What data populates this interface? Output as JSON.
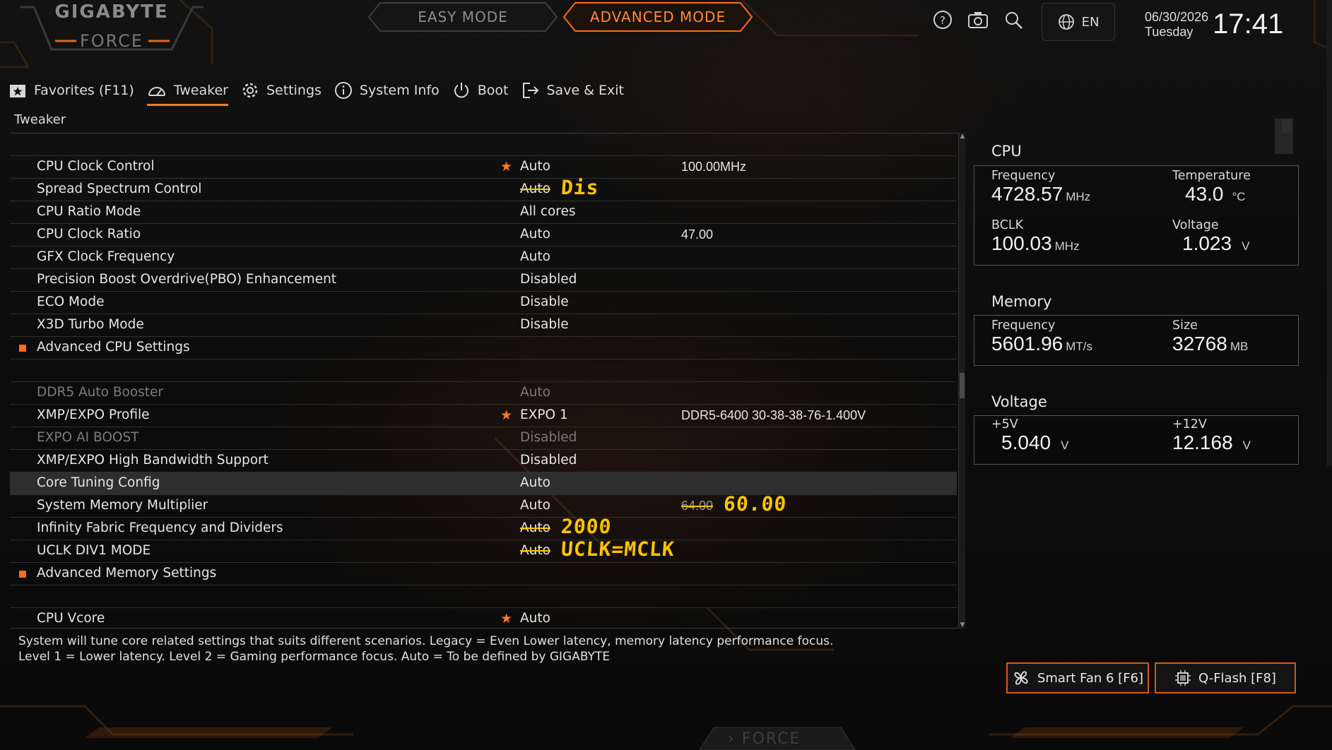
{
  "brand": {
    "line1": "GIGABYTE",
    "line2": "FORCE"
  },
  "modes": {
    "easy": "EASY MODE",
    "advanced": "ADVANCED MODE",
    "active": "advanced"
  },
  "top_icons": [
    "help-icon",
    "screenshot-camera-icon",
    "search-icon"
  ],
  "language": {
    "label": "EN",
    "icon": "globe-icon"
  },
  "datetime": {
    "date": "06/30/2026",
    "day": "Tuesday",
    "time": "17:41"
  },
  "nav": {
    "items": [
      {
        "label": "Favorites (F11)",
        "icon": "star-folder-icon"
      },
      {
        "label": "Tweaker",
        "icon": "speedometer-icon",
        "active": true
      },
      {
        "label": "Settings",
        "icon": "gear-icon"
      },
      {
        "label": "System Info",
        "icon": "info-icon"
      },
      {
        "label": "Boot",
        "icon": "power-icon"
      },
      {
        "label": "Save & Exit",
        "icon": "exit-icon"
      }
    ]
  },
  "breadcrumb": "Tweaker",
  "settings": {
    "rows": [
      {
        "name": "CPU Clock Control",
        "starred": true,
        "value": "Auto",
        "extra": "100.00MHz"
      },
      {
        "name": "Spread Spectrum Control",
        "value": "Auto",
        "struck": true,
        "annotation": "Dis"
      },
      {
        "name": "CPU Ratio Mode",
        "value": "All cores"
      },
      {
        "name": "CPU Clock Ratio",
        "value": "Auto",
        "extra": "47.00"
      },
      {
        "name": "GFX Clock Frequency",
        "value": "Auto"
      },
      {
        "name": "Precision Boost Overdrive(PBO) Enhancement",
        "value": "Disabled"
      },
      {
        "name": "ECO Mode",
        "value": "Disable"
      },
      {
        "name": "X3D Turbo Mode",
        "value": "Disable"
      },
      {
        "name": "Advanced CPU Settings",
        "submenu": true
      },
      {
        "name": "DDR5 Auto Booster",
        "value": "Auto",
        "disabled": true
      },
      {
        "name": "XMP/EXPO Profile",
        "starred": true,
        "value": "EXPO 1",
        "extra": "DDR5-6400 30-38-38-76-1.400V"
      },
      {
        "name": "EXPO AI BOOST",
        "value": "Disabled",
        "disabled": true
      },
      {
        "name": "XMP/EXPO High Bandwidth Support",
        "value": "Disabled"
      },
      {
        "name": "Core Tuning Config",
        "value": "Auto",
        "selected": true
      },
      {
        "name": "System Memory Multiplier",
        "value": "Auto",
        "extra": "64.00",
        "extra_struck": true,
        "annotation": "60.00"
      },
      {
        "name": "Infinity Fabric Frequency and Dividers",
        "value": "Auto",
        "struck": true,
        "annotation": "2000"
      },
      {
        "name": "UCLK DIV1 MODE",
        "value": "Auto",
        "struck": true,
        "annotation": "UCLK=MCLK"
      },
      {
        "name": "Advanced Memory Settings",
        "submenu": true
      },
      {
        "name": "CPU Vcore",
        "starred": true,
        "value": "Auto"
      }
    ]
  },
  "help_text": "System will tune core related settings that suits different scenarios. Legacy = Even Lower latency, memory latency performance focus. Level 1 = Lower latency. Level 2 = Gaming performance focus. Auto = To be defined by GIGABYTE",
  "side": {
    "cpu": {
      "title": "CPU",
      "frequency": {
        "label": "Frequency",
        "value": "4728.57",
        "unit": "MHz"
      },
      "temperature": {
        "label": "Temperature",
        "value": "43.0",
        "unit": "°C"
      },
      "bclk": {
        "label": "BCLK",
        "value": "100.03",
        "unit": "MHz"
      },
      "voltage": {
        "label": "Voltage",
        "value": "1.023",
        "unit": "V"
      }
    },
    "memory": {
      "title": "Memory",
      "frequency": {
        "label": "Frequency",
        "value": "5601.96",
        "unit": "MT/s"
      },
      "size": {
        "label": "Size",
        "value": "32768",
        "unit": "MB"
      }
    },
    "voltage": {
      "title": "Voltage",
      "v5": {
        "label": "+5V",
        "value": "5.040",
        "unit": "V"
      },
      "v12": {
        "label": "+12V",
        "value": "12.168",
        "unit": "V"
      }
    }
  },
  "footer_buttons": {
    "smart_fan": {
      "label": "Smart Fan 6 [F6]",
      "icon": "fan-icon"
    },
    "qflash": {
      "label": "Q-Flash [F8]",
      "icon": "chip-icon"
    }
  },
  "bottom_brand": "FORCE",
  "colors": {
    "accent": "#ff7a2a",
    "annotation": "#ffc400",
    "background": "#0b0b0b"
  }
}
